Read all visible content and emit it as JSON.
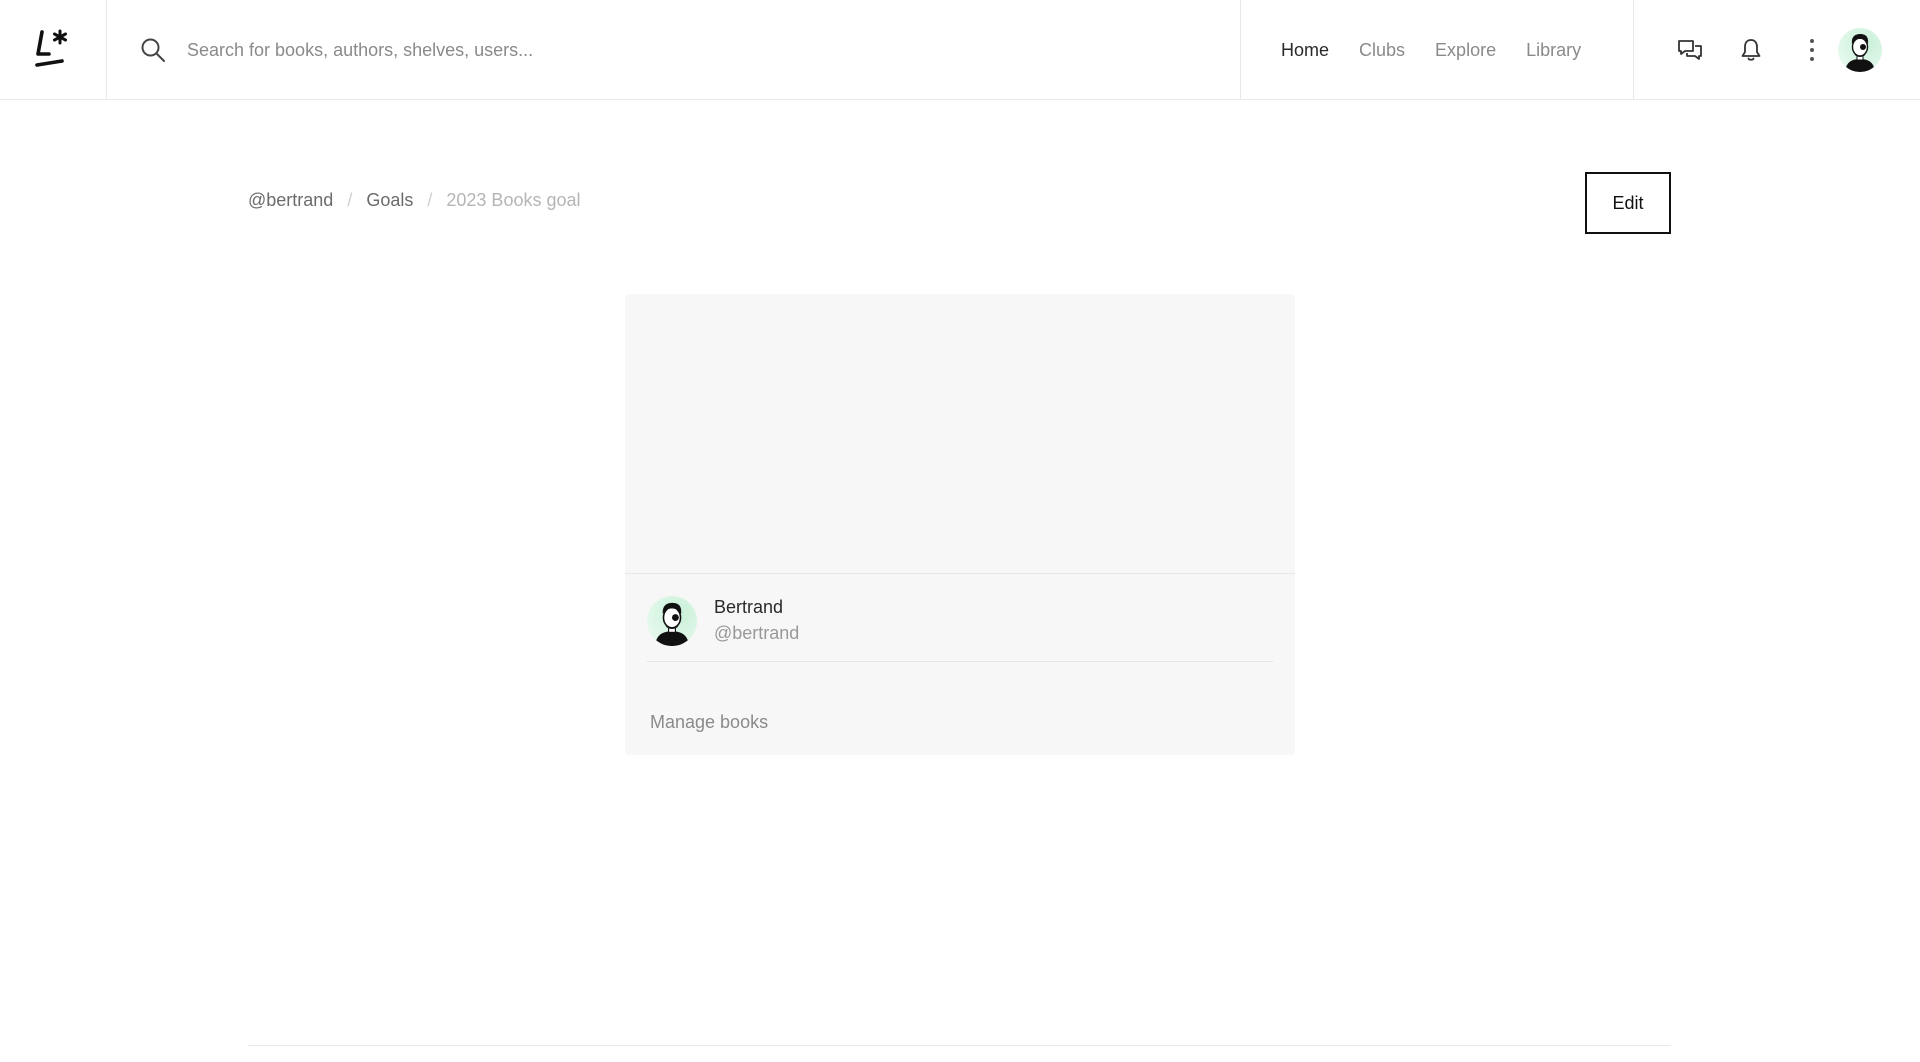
{
  "app": {
    "logo_text": "L*"
  },
  "search": {
    "placeholder": "Search for books, authors, shelves, users...",
    "value": ""
  },
  "nav": {
    "items": [
      {
        "label": "Home",
        "active": true
      },
      {
        "label": "Clubs",
        "active": false
      },
      {
        "label": "Explore",
        "active": false
      },
      {
        "label": "Library",
        "active": false
      }
    ]
  },
  "header_icons": [
    "chat-icon",
    "bell-icon",
    "more-vertical-icon",
    "avatar"
  ],
  "breadcrumb": {
    "items": [
      "@bertrand",
      "Goals",
      "2023 Books goal"
    ],
    "separator": "/"
  },
  "edit_label": "Edit",
  "card": {
    "user_name": "Bertrand",
    "user_handle": "@bertrand",
    "manage_label": "Manage books"
  },
  "colors": {
    "text_primary": "#2a2a2a",
    "text_muted": "#8a8a8a",
    "card_bg": "#f7f7f7",
    "border": "#e9e9e9",
    "avatar_bg": "#dff7e8"
  }
}
